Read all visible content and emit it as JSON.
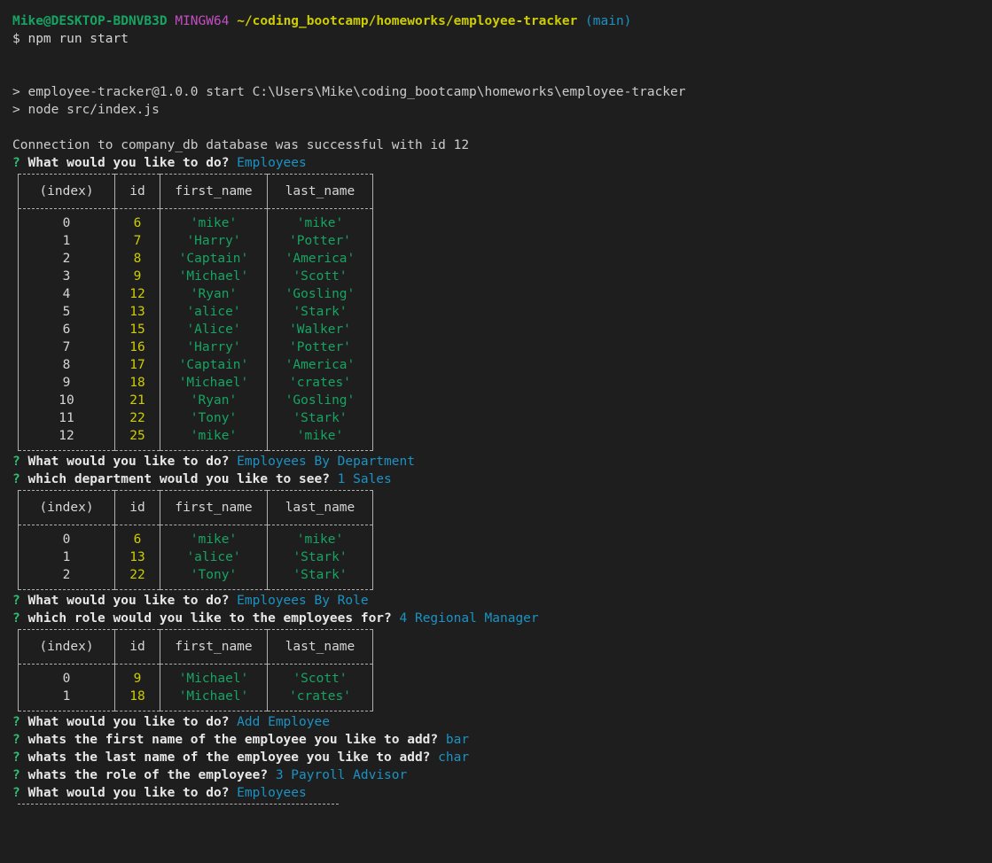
{
  "terminal": {
    "prompt": {
      "user_host": "Mike@DESKTOP-BDNVB3D",
      "shell": "MINGW64",
      "path": "~/coding_bootcamp/homeworks/employee-tracker",
      "branch": "(main)",
      "dollar": "$",
      "command": "npm run start"
    },
    "npm_lines": [
      "> employee-tracker@1.0.0 start C:\\Users\\Mike\\coding_bootcamp\\homeworks\\employee-tracker",
      "> node src/index.js"
    ],
    "connection_message": "Connection to company_db database was successful with id 12",
    "question_marker": "?",
    "table_headers": [
      "(index)",
      "id",
      "first_name",
      "last_name"
    ],
    "sequence": [
      {
        "type": "question",
        "question": "What would you like to do?",
        "answer": "Employees"
      },
      {
        "type": "table",
        "rows": [
          {
            "index": "0",
            "id": "6",
            "first_name": "'mike'",
            "last_name": "'mike'"
          },
          {
            "index": "1",
            "id": "7",
            "first_name": "'Harry'",
            "last_name": "'Potter'"
          },
          {
            "index": "2",
            "id": "8",
            "first_name": "'Captain'",
            "last_name": "'America'"
          },
          {
            "index": "3",
            "id": "9",
            "first_name": "'Michael'",
            "last_name": "'Scott'"
          },
          {
            "index": "4",
            "id": "12",
            "first_name": "'Ryan'",
            "last_name": "'Gosling'"
          },
          {
            "index": "5",
            "id": "13",
            "first_name": "'alice'",
            "last_name": "'Stark'"
          },
          {
            "index": "6",
            "id": "15",
            "first_name": "'Alice'",
            "last_name": "'Walker'"
          },
          {
            "index": "7",
            "id": "16",
            "first_name": "'Harry'",
            "last_name": "'Potter'"
          },
          {
            "index": "8",
            "id": "17",
            "first_name": "'Captain'",
            "last_name": "'America'"
          },
          {
            "index": "9",
            "id": "18",
            "first_name": "'Michael'",
            "last_name": "'crates'"
          },
          {
            "index": "10",
            "id": "21",
            "first_name": "'Ryan'",
            "last_name": "'Gosling'"
          },
          {
            "index": "11",
            "id": "22",
            "first_name": "'Tony'",
            "last_name": "'Stark'"
          },
          {
            "index": "12",
            "id": "25",
            "first_name": "'mike'",
            "last_name": "'mike'"
          }
        ]
      },
      {
        "type": "question",
        "question": "What would you like to do?",
        "answer": "Employees By Department"
      },
      {
        "type": "question",
        "question": "which department would you like to see?",
        "answer": "1 Sales"
      },
      {
        "type": "table",
        "rows": [
          {
            "index": "0",
            "id": "6",
            "first_name": "'mike'",
            "last_name": "'mike'"
          },
          {
            "index": "1",
            "id": "13",
            "first_name": "'alice'",
            "last_name": "'Stark'"
          },
          {
            "index": "2",
            "id": "22",
            "first_name": "'Tony'",
            "last_name": "'Stark'"
          }
        ]
      },
      {
        "type": "question",
        "question": "What would you like to do?",
        "answer": "Employees By Role"
      },
      {
        "type": "question",
        "question": "which role would you like to the employees for?",
        "answer": "4 Regional Manager"
      },
      {
        "type": "table",
        "rows": [
          {
            "index": "0",
            "id": "9",
            "first_name": "'Michael'",
            "last_name": "'Scott'"
          },
          {
            "index": "1",
            "id": "18",
            "first_name": "'Michael'",
            "last_name": "'crates'"
          }
        ]
      },
      {
        "type": "question",
        "question": "What would you like to do?",
        "answer": "Add Employee"
      },
      {
        "type": "question",
        "question": "whats the first name of the employee you like to add?",
        "answer": "bar"
      },
      {
        "type": "question",
        "question": "whats the last name of the employee you like to add?",
        "answer": "char"
      },
      {
        "type": "question",
        "question": "whats the role of the employee?",
        "answer": "3 Payroll Advisor"
      },
      {
        "type": "question",
        "question": "What would you like to do?",
        "answer": "Employees"
      },
      {
        "type": "partial-table"
      }
    ]
  }
}
